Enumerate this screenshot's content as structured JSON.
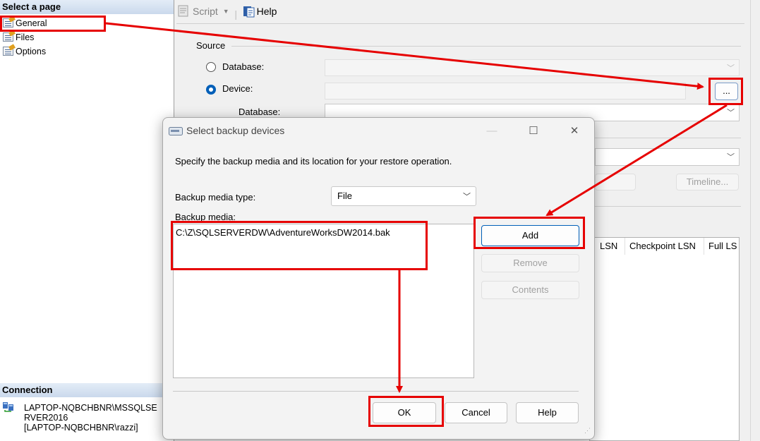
{
  "left_pane": {
    "select_page_header": "Select a page",
    "pages": [
      {
        "label": "General"
      },
      {
        "label": "Files"
      },
      {
        "label": "Options"
      }
    ],
    "connection_header": "Connection",
    "connection_lines": [
      "LAPTOP-NQBCHBNR\\MSSQLSE",
      "RVER2016",
      "[LAPTOP-NQBCHBNR\\razzi]"
    ]
  },
  "toolbar": {
    "script_label": "Script",
    "help_label": "Help"
  },
  "source": {
    "group_label": "Source",
    "database_radio_label": "Database:",
    "device_radio_label": "Device:",
    "device_browse_label": "...",
    "database_label": "Database:",
    "selected": "Device"
  },
  "restore": {
    "timeline_button": "Timeline...",
    "grid_columns": [
      "LSN",
      "Checkpoint LSN",
      "Full LS"
    ]
  },
  "dialog": {
    "title": "Select backup devices",
    "instruction": "Specify the backup media and its location for your restore operation.",
    "media_type_label": "Backup media type:",
    "media_type_value": "File",
    "media_label": "Backup media:",
    "media_items": [
      "C:\\Z\\SQLSERVERDW\\AdventureWorksDW2014.bak"
    ],
    "add_button": "Add",
    "remove_button": "Remove",
    "contents_button": "Contents",
    "ok_button": "OK",
    "cancel_button": "Cancel",
    "help_button": "Help",
    "controls": {
      "minimize": "—",
      "maximize": "☐",
      "close": "✕"
    }
  },
  "colors": {
    "annotation_red": "#e60000",
    "accent_blue": "#005fb8"
  }
}
